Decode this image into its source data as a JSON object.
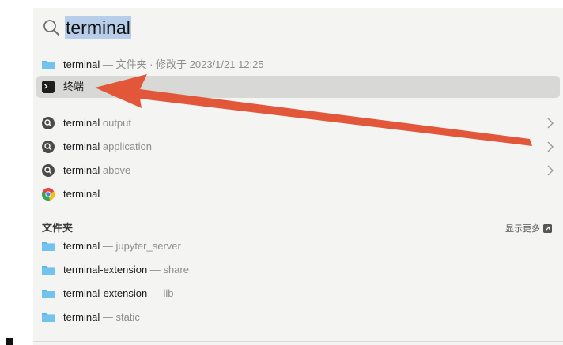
{
  "search": {
    "query": "terminal"
  },
  "top_hit": {
    "name": "terminal",
    "detail": " — 文件夹 · 修改于 2023/1/21 12:25",
    "icon": "folder-icon"
  },
  "selected": {
    "name": "终端",
    "icon": "terminal-app-icon"
  },
  "suggestions": [
    {
      "bold": "terminal",
      "rest": " output",
      "icon": "search-suggestion-icon"
    },
    {
      "bold": "terminal",
      "rest": " application",
      "icon": "search-suggestion-icon"
    },
    {
      "bold": "terminal",
      "rest": " above",
      "icon": "search-suggestion-icon"
    },
    {
      "bold": "terminal",
      "rest": "",
      "icon": "chrome-icon"
    }
  ],
  "folders_section": {
    "title": "文件夹",
    "show_more": "显示更多",
    "items": [
      {
        "name": "terminal",
        "detail": " — jupyter_server"
      },
      {
        "name": "terminal-extension",
        "detail": " — share"
      },
      {
        "name": "terminal-extension",
        "detail": " — lib"
      },
      {
        "name": "terminal",
        "detail": " — static"
      }
    ]
  },
  "colors": {
    "highlight": "#b7cdea",
    "arrow": "#e2573a",
    "folder": "#5fb7ea"
  }
}
